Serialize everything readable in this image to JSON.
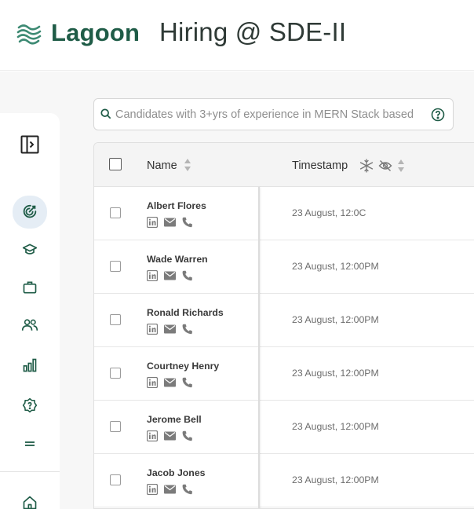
{
  "app": {
    "brand": "Lagoon",
    "page_title": "Hiring @ SDE-II"
  },
  "search": {
    "placeholder": "Candidates with 3+yrs of experience in MERN Stack based"
  },
  "sidebar": {
    "items": [
      {
        "icon": "panel-toggle-icon"
      },
      {
        "icon": "target-icon",
        "active": true
      },
      {
        "icon": "graduation-cap-icon"
      },
      {
        "icon": "briefcase-icon"
      },
      {
        "icon": "users-icon"
      },
      {
        "icon": "bar-chart-icon"
      },
      {
        "icon": "settings-badge-icon"
      },
      {
        "icon": "menu-icon"
      },
      {
        "icon": "home-icon"
      }
    ]
  },
  "table": {
    "columns": [
      {
        "label": "Name"
      },
      {
        "label": "Timestamp"
      }
    ],
    "rows": [
      {
        "name": "Albert Flores",
        "timestamp": "23 August, 12:0C"
      },
      {
        "name": "Wade Warren",
        "timestamp": "23 August, 12:00PM"
      },
      {
        "name": "Ronald Richards",
        "timestamp": "23 August, 12:00PM"
      },
      {
        "name": "Courtney Henry",
        "timestamp": "23 August, 12:00PM"
      },
      {
        "name": "Jerome Bell",
        "timestamp": "23 August, 12:00PM"
      },
      {
        "name": "Jacob Jones",
        "timestamp": "23 August, 12:00PM"
      }
    ]
  },
  "colors": {
    "brand": "#1f5c47",
    "active_bg": "#e5edf5",
    "icon_green": "#1f5c47"
  }
}
